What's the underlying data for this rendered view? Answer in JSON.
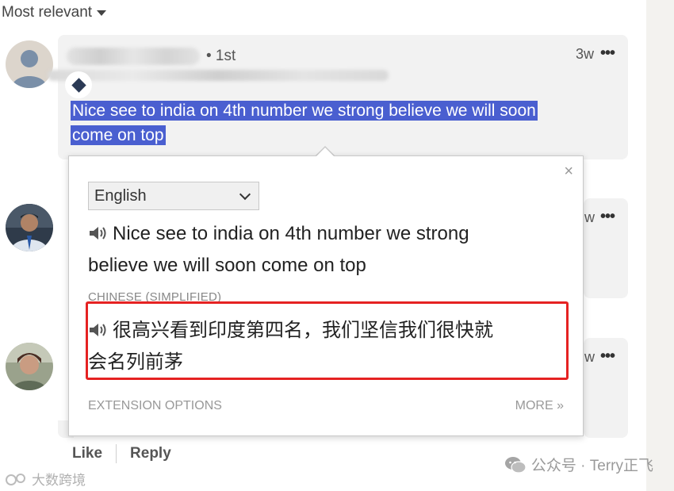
{
  "sort": {
    "label": "Most relevant"
  },
  "comments": [
    {
      "degree": "• 1st",
      "time": "3w",
      "more": "•••",
      "text_line1": "Nice see to india on 4th number we strong believe we will soon",
      "text_line2": "come on top"
    },
    {
      "time": "w",
      "more": "•••"
    },
    {
      "time": "w",
      "more": "•••"
    }
  ],
  "actions": {
    "like": "Like",
    "reply": "Reply"
  },
  "translate_popup": {
    "close": "×",
    "selected_language": "English",
    "source_line1": "Nice see to india on 4th number we strong",
    "source_line2": "believe we will soon come on top",
    "target_language_label": "CHINESE (SIMPLIFIED)",
    "translation_line1": "很高兴看到印度第四名，我们坚信我们很快就",
    "translation_line2": "会名列前茅",
    "extension_options": "EXTENSION OPTIONS",
    "more": "MORE »"
  },
  "watermarks": {
    "right": "公众号 · Terry正飞",
    "left": "大数跨境"
  },
  "colors": {
    "selection": "#4a5fd0",
    "highlight_box": "#e52222",
    "bubble": "#f2f2f2"
  },
  "icons": [
    "caret-down-icon",
    "speaker-icon",
    "close-icon",
    "chevron-down-icon",
    "more-dots-icon",
    "wechat-icon"
  ]
}
